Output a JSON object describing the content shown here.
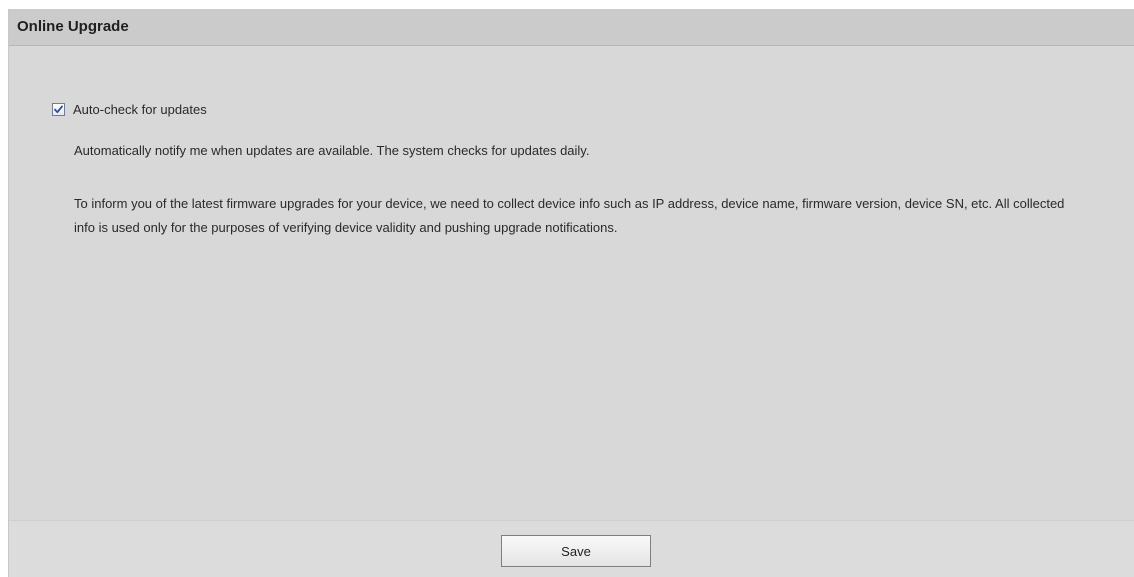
{
  "header": {
    "title": "Online Upgrade"
  },
  "auto_check": {
    "label": "Auto-check for updates",
    "checked": true
  },
  "description": "Automatically notify me when updates are available. The system checks for updates daily.",
  "privacy_notice": "To inform you of the latest firmware upgrades for your device, we need to collect device info such as IP address, device name, firmware version, device SN, etc. All collected info is used only for the purposes of verifying device validity and pushing upgrade notifications.",
  "footer": {
    "save_label": "Save"
  },
  "colors": {
    "panel_background": "#d8d8d8",
    "header_background": "#cbcbcb",
    "checkmark": "#2b4f9e"
  },
  "icons": {
    "checkbox": "checkmark-icon"
  }
}
